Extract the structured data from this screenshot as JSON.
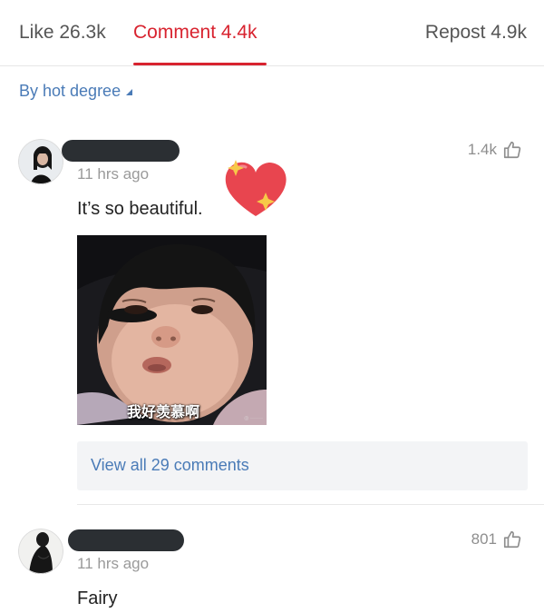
{
  "tabs": {
    "like": "Like 26.3k",
    "comment": "Comment 4.4k",
    "repost": "Repost 4.9k",
    "active_color": "#d8232f"
  },
  "sort": {
    "label": "By hot degree"
  },
  "comments": [
    {
      "time": "11 hrs ago",
      "likes": "1.4k",
      "text": "It’s so beautiful.",
      "image_caption": "我好羡慕啊",
      "view_all": "View all 29 comments"
    },
    {
      "time": "11 hrs ago",
      "likes": "801",
      "text": "Fairy"
    }
  ],
  "icons": [
    "thumbs-up-icon",
    "heart-sticker-icon"
  ],
  "colors": {
    "link": "#4a7bb7",
    "accent": "#d8232f",
    "name_redaction": "#2b2f33"
  }
}
